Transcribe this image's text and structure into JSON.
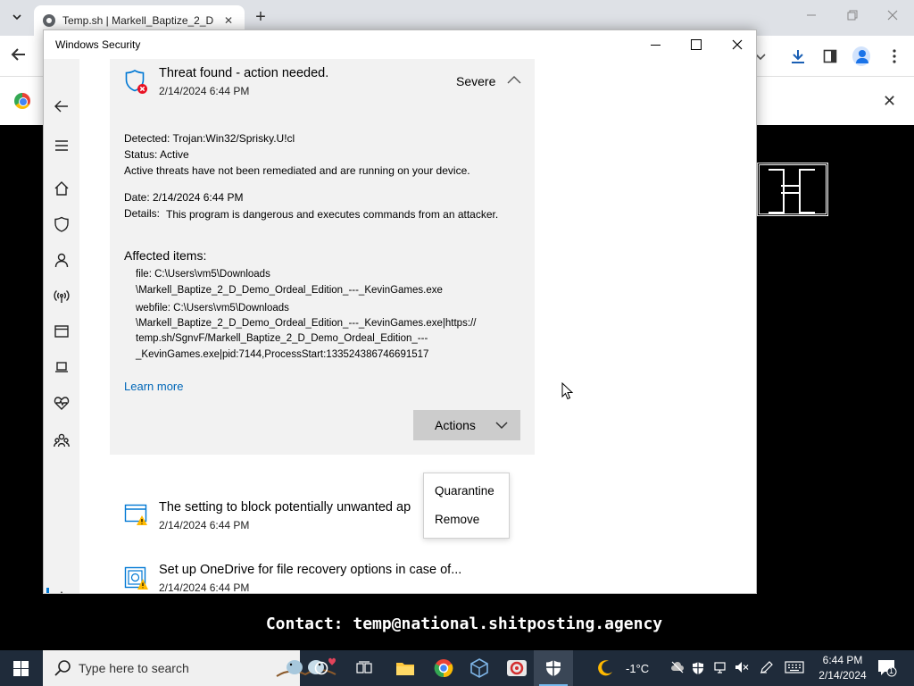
{
  "browser": {
    "tab_title": "Temp.sh | Markell_Baptize_2_D",
    "tab_close": "✕",
    "new_tab": "+",
    "infobar_close": "✕"
  },
  "page": {
    "contact": "Contact: temp@national.shitposting.agency"
  },
  "window": {
    "title": "Windows Security"
  },
  "threat": {
    "title": "Threat found - action needed.",
    "date": "2/14/2024 6:44 PM",
    "severity": "Severe",
    "detected_label": "Detected:",
    "detected_value": "Trojan:Win32/Sprisky.U!cl",
    "status_label": "Status:",
    "status_value": "Active",
    "status_note": "Active threats have not been remediated and are running on your device.",
    "date_label": "Date:",
    "date_value": "2/14/2024 6:44 PM",
    "details_label": "Details:",
    "details_value": "This program is dangerous and executes commands from an attacker.",
    "affected_title": "Affected items:",
    "affected_lines": [
      "file: C:\\Users\\vm5\\Downloads",
      "\\Markell_Baptize_2_D_Demo_Ordeal_Edition_---_KevinGames.exe",
      "webfile: C:\\Users\\vm5\\Downloads",
      "\\Markell_Baptize_2_D_Demo_Ordeal_Edition_---_KevinGames.exe|https://",
      "temp.sh/SgnvF/Markell_Baptize_2_D_Demo_Ordeal_Edition_---",
      "_KevinGames.exe|pid:7144,ProcessStart:133524386746691517"
    ],
    "learn_more": "Learn more",
    "actions_label": "Actions"
  },
  "actions_menu": {
    "items": [
      "Quarantine",
      "Remove"
    ]
  },
  "recommendations": [
    {
      "title": "The setting to block potentially unwanted ap",
      "date": "2/14/2024 6:44 PM",
      "icon": "window-warning-icon"
    },
    {
      "title": "Set up OneDrive for file recovery options in case of...",
      "date": "2/14/2024 6:44 PM",
      "icon": "recovery-warning-icon"
    }
  ],
  "taskbar": {
    "search_placeholder": "Type here to search",
    "weather": "-1°C",
    "time": "6:44 PM",
    "date": "2/14/2024",
    "notification_count": "1"
  },
  "colors": {
    "accent": "#0078d4",
    "link": "#0067b8",
    "danger": "#e81123",
    "warning": "#ffb900"
  }
}
